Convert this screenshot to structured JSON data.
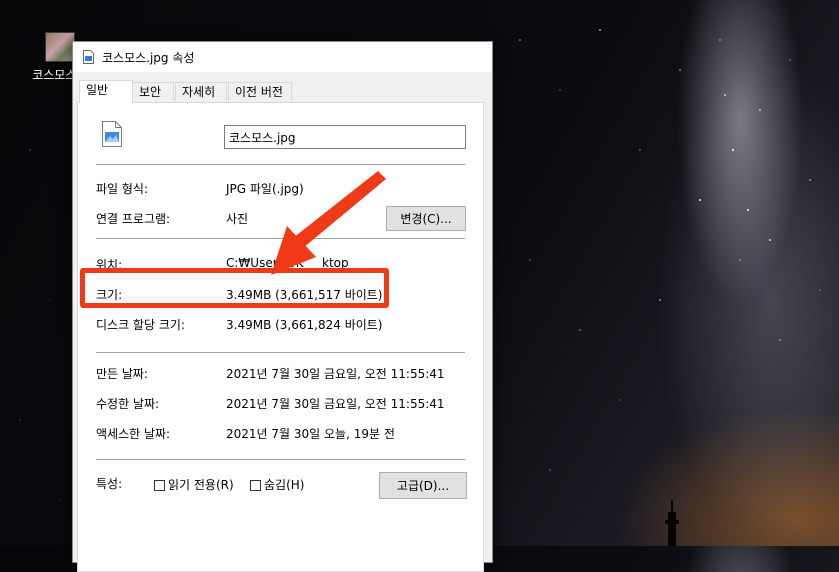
{
  "desktop": {
    "icon_label": "코스모스..."
  },
  "dialog": {
    "title": "코스모스.jpg 속성",
    "tabs": [
      "일반",
      "보안",
      "자세히",
      "이전 버전"
    ],
    "file_name": "코스모스.jpg",
    "rows": {
      "file_type": {
        "label": "파일 형식:",
        "value": "JPG 파일(.jpg)"
      },
      "opens_with": {
        "label": "연결 프로그램:",
        "value": "사진"
      },
      "location": {
        "label": "위치:",
        "value": "C:₩Users₩K"
      },
      "location_tail": "ktop",
      "size": {
        "label": "크기:",
        "value": "3.49MB (3,661,517 바이트)"
      },
      "size_on_disk": {
        "label": "디스크 할당 크기:",
        "value": "3.49MB (3,661,824 바이트)"
      },
      "created": {
        "label": "만든 날짜:",
        "value": "2021년 7월 30일 금요일, 오전 11:55:41"
      },
      "modified": {
        "label": "수정한 날짜:",
        "value": "2021년 7월 30일 금요일, 오전 11:55:41"
      },
      "accessed": {
        "label": "액세스한 날짜:",
        "value": "2021년 7월 30일 오늘, 19분 전"
      }
    },
    "change_button": "변경(C)...",
    "attributes_label": "특성:",
    "readonly_label": "읽기 전용(R)",
    "hidden_label": "숨김(H)",
    "advanced_button": "고급(D)..."
  },
  "annotation": {
    "highlight_color": "#f03a17"
  }
}
